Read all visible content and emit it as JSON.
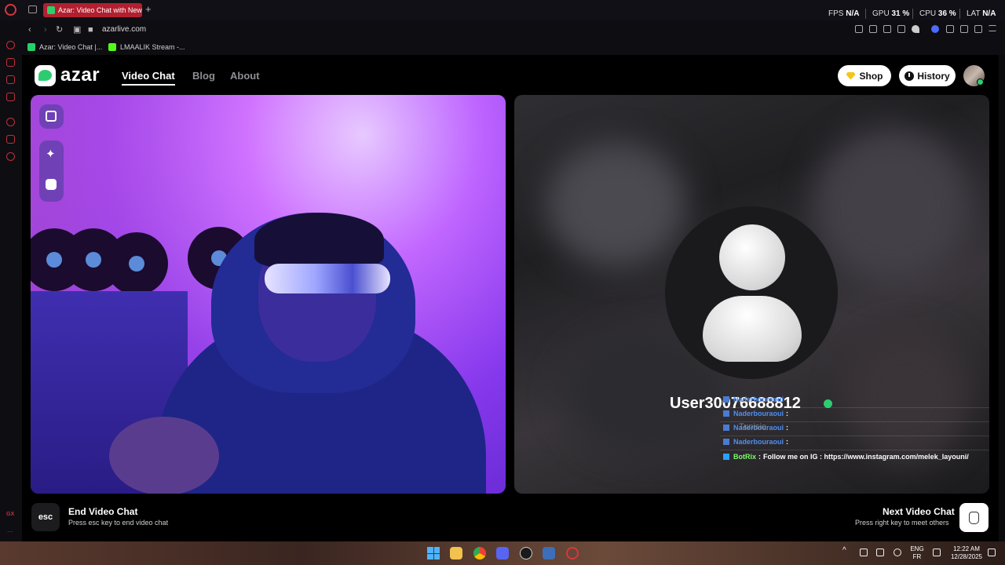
{
  "browser": {
    "tab_title": "Azar: Video Chat with New",
    "new_tab_symbol": "+",
    "url": "azarlive.com",
    "hud": {
      "fps_label": "FPS",
      "fps_value": "N/A",
      "gpu_label": "GPU",
      "gpu_value": "31 %",
      "cpu_label": "CPU",
      "cpu_value": "36 %",
      "lat_label": "LAT",
      "lat_value": "N/A"
    },
    "bookmarks": [
      {
        "label": "Azar: Video Chat |...",
        "color": "#27d16a"
      },
      {
        "label": "LMAALIK Stream -...",
        "color": "#53fc18"
      }
    ],
    "sidebar_gx_label": "GX",
    "sidebar_more_label": "..."
  },
  "header": {
    "logo_text": "azar",
    "nav": [
      {
        "label": "Video Chat",
        "active": true
      },
      {
        "label": "Blog",
        "active": false
      },
      {
        "label": "About",
        "active": false
      }
    ],
    "shop_label": "Shop",
    "history_label": "History"
  },
  "remote": {
    "username": "User30076688812",
    "chat": [
      {
        "name": "Naderbouraoui",
        "sep": ":",
        "text": ""
      },
      {
        "name": "Naderbouraoui",
        "sep": ":",
        "text": ""
      },
      {
        "name": "Naderbouraoui",
        "sep": ":",
        "text": ""
      },
      {
        "name": "Naderbouraoui",
        "sep": ":",
        "text": ""
      },
      {
        "name": "BotRix",
        "sep": ":",
        "text": "Follow me on IG : https://www.instagram.com/melek_layouni/"
      }
    ],
    "overlay_fragment": "Tunisie"
  },
  "footer": {
    "esc_key": "esc",
    "end_title": "End Video Chat",
    "end_sub": "Press esc key to end video chat",
    "next_title": "Next Video Chat",
    "next_sub": "Press right key to meet others"
  },
  "taskbar": {
    "lang_top": "ENG",
    "lang_bottom": "FR",
    "time": "12:22 AM",
    "date": "12/28/2025",
    "chevron": "^"
  },
  "colors": {
    "accent_red": "#b22030",
    "brand_green": "#2ecc71",
    "chat_name_blue": "#4e8ff0",
    "botrix_green": "#7cfc6a"
  }
}
